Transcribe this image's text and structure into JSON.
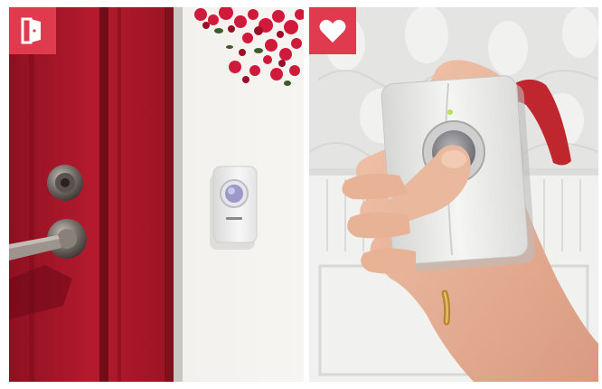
{
  "panels": [
    {
      "id": "entrance",
      "badge_icon": "door-icon",
      "badge_color": "#e03a4e",
      "door_color": "#b01a2c",
      "wall_color": "#f2f0ec",
      "flower_color": "#d01a3c"
    },
    {
      "id": "portable",
      "badge_icon": "heart-icon",
      "badge_color": "#e03a4e",
      "wallpaper_color": "#e8e8e8",
      "strap_color": "#c0262e"
    }
  ]
}
